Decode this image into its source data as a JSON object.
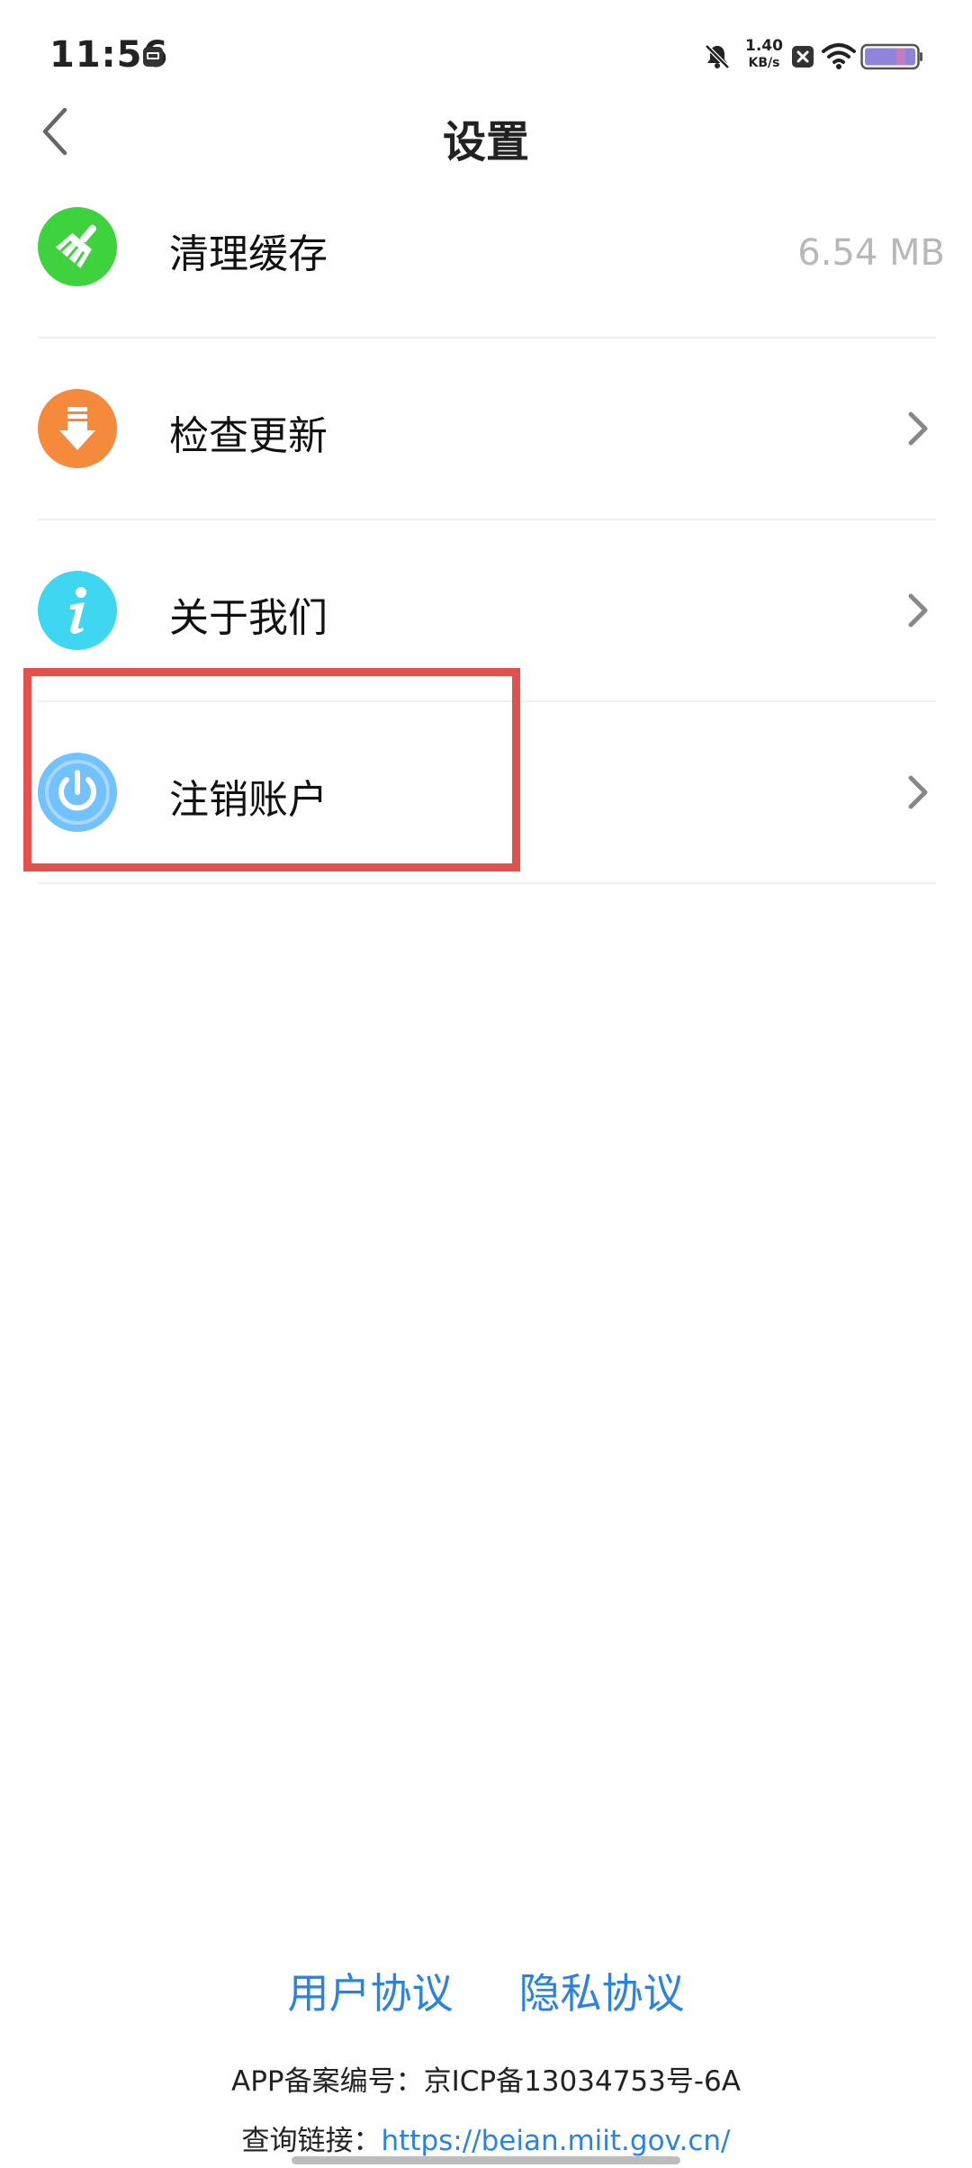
{
  "status_bar": {
    "time": "11:56",
    "net_speed_value": "1.40",
    "net_speed_unit": "KB/s",
    "icons": [
      "sim-card-icon",
      "bell-muted-icon",
      "close-box-icon",
      "wifi-icon",
      "battery-icon"
    ]
  },
  "header": {
    "title": "设置",
    "back_icon": "chevron-left-icon"
  },
  "settings": {
    "items": [
      {
        "label": "清理缓存",
        "value": "6.54 MB",
        "icon": "broom-icon",
        "icon_color": "#3fd23f"
      },
      {
        "label": "检查更新",
        "icon": "download-icon",
        "icon_color": "#f5893c"
      },
      {
        "label": "关于我们",
        "icon": "info-icon",
        "icon_color": "#3ed6f0"
      },
      {
        "label": "注销账户",
        "icon": "power-icon",
        "icon_color": "#72c2ff"
      }
    ]
  },
  "footer": {
    "user_agreement": "用户协议",
    "privacy_agreement": "隐私协议",
    "icp_record": "APP备案编号：京ICP备13034753号-6A",
    "query_label": "查询链接：",
    "query_link": "https://beian.miit.gov.cn/"
  },
  "colors": {
    "link": "#2a83e0",
    "highlight": "#e2514d",
    "divider": "#efefef"
  }
}
